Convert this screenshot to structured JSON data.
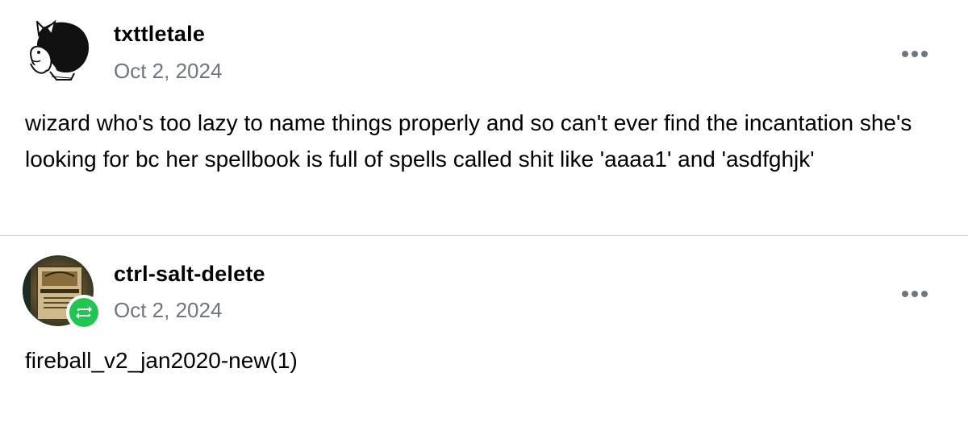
{
  "posts": [
    {
      "username": "txttletale",
      "date": "Oct 2, 2024",
      "body": "wizard who's too lazy to name things properly and so can't ever find the incantation she's looking for bc her spellbook is full of spells called shit like 'aaaa1' and 'asdfghjk'",
      "avatar_icon": "cartoon-girl-avatar-icon",
      "menu_icon": "more-options-icon"
    },
    {
      "username": "ctrl-salt-delete",
      "date": "Oct 2, 2024",
      "body": "fireball_v2_jan2020-new(1)",
      "avatar_icon": "book-photo-avatar-icon",
      "badge_icon": "reblog-icon",
      "menu_icon": "more-options-icon"
    }
  ],
  "colors": {
    "date_text": "#6f7680",
    "reblog_badge": "#22c452",
    "divider": "#cfcfcf"
  }
}
